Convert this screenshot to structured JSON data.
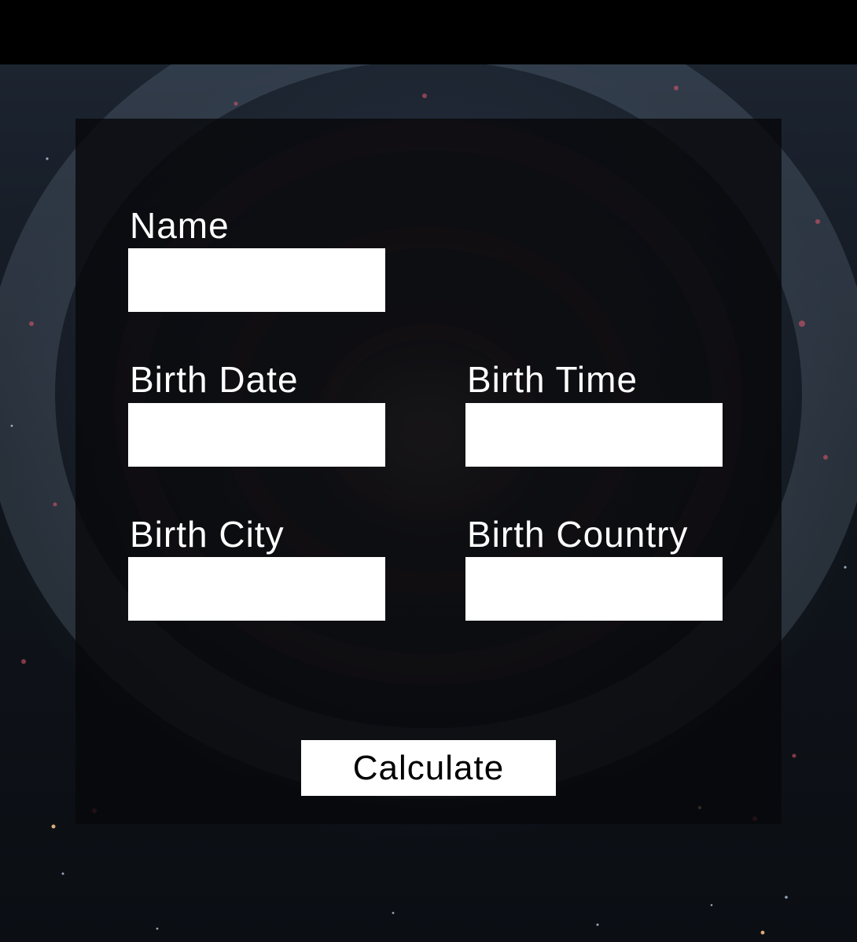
{
  "form": {
    "name": {
      "label": "Name",
      "value": ""
    },
    "birth_date": {
      "label": "Birth Date",
      "value": ""
    },
    "birth_time": {
      "label": "Birth Time",
      "value": ""
    },
    "birth_city": {
      "label": "Birth City",
      "value": ""
    },
    "birth_country": {
      "label": "Birth Country",
      "value": ""
    },
    "submit_label": "Calculate"
  },
  "colors": {
    "panel": "#08080a",
    "input_background": "#ffffff",
    "label_text": "#ffffff",
    "button_background": "#ffffff",
    "button_text": "#000000"
  }
}
